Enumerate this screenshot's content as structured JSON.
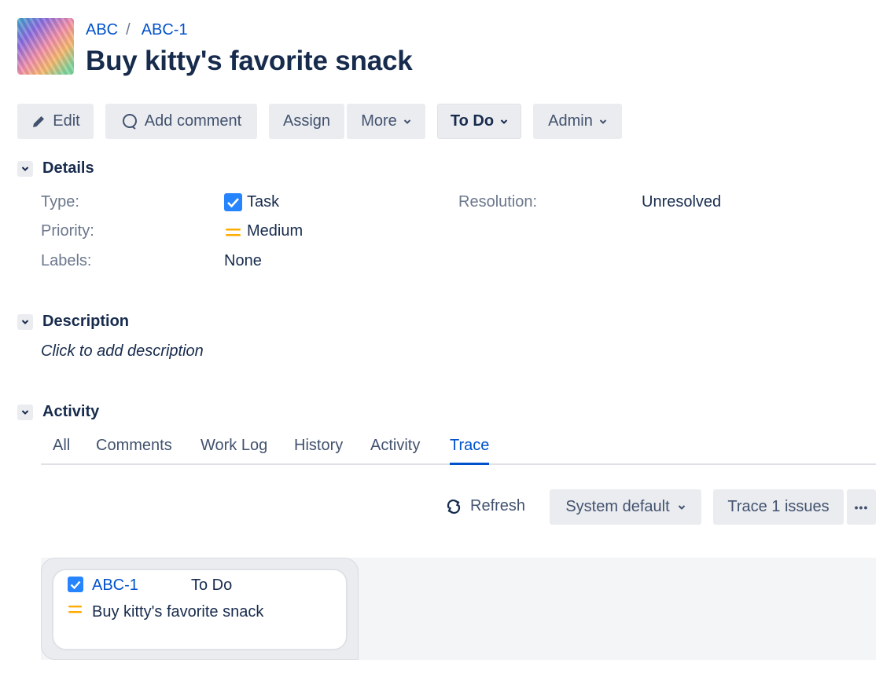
{
  "breadcrumb": {
    "project": "ABC",
    "separator": "/",
    "issue_key": "ABC-1"
  },
  "issue": {
    "title": "Buy kitty's favorite snack"
  },
  "toolbar": {
    "edit": "Edit",
    "add_comment": "Add comment",
    "assign": "Assign",
    "more": "More",
    "status": "To Do",
    "admin": "Admin"
  },
  "details": {
    "heading": "Details",
    "type_label": "Type:",
    "type_value": "Task",
    "priority_label": "Priority:",
    "priority_value": "Medium",
    "labels_label": "Labels:",
    "labels_value": "None",
    "resolution_label": "Resolution:",
    "resolution_value": "Unresolved"
  },
  "description": {
    "heading": "Description",
    "placeholder": "Click to add description"
  },
  "activity": {
    "heading": "Activity",
    "tabs": [
      "All",
      "Comments",
      "Work Log",
      "History",
      "Activity",
      "Trace"
    ],
    "active_tab": "Trace"
  },
  "trace": {
    "refresh": "Refresh",
    "layout": "System default",
    "trace_button": "Trace 1 issues",
    "more": "•••",
    "card": {
      "key": "ABC-1",
      "status": "To Do",
      "summary": "Buy kitty's favorite snack"
    }
  },
  "colors": {
    "link": "#0052cc",
    "task_icon": "#2684ff",
    "priority_medium": "#ffab00",
    "text": "#172b4d"
  }
}
